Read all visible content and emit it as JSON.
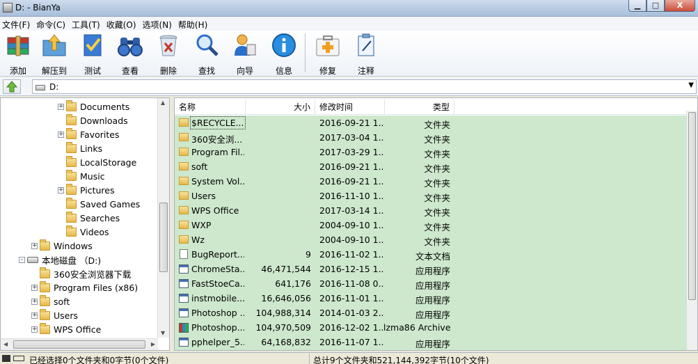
{
  "window": {
    "title": "D: - BianYa",
    "min_label": "▁",
    "max_label": "□",
    "close_label": "X"
  },
  "menu": [
    "文件(F)",
    "命令(C)",
    "工具(T)",
    "收藏(O)",
    "选项(N)",
    "帮助(H)"
  ],
  "toolbar": {
    "add": "添加",
    "extract": "解压到",
    "test": "测试",
    "view": "查看",
    "delete": "删除",
    "find": "查找",
    "wizard": "向导",
    "info": "信息",
    "repair": "修复",
    "comment": "注释"
  },
  "address": {
    "path": "D:"
  },
  "tree": [
    {
      "label": "Documents",
      "expander": "+"
    },
    {
      "label": "Downloads",
      "expander": ""
    },
    {
      "label": "Favorites",
      "expander": "+"
    },
    {
      "label": "Links",
      "expander": ""
    },
    {
      "label": "LocalStorage",
      "expander": ""
    },
    {
      "label": "Music",
      "expander": ""
    },
    {
      "label": "Pictures",
      "expander": "+"
    },
    {
      "label": "Saved Games",
      "expander": ""
    },
    {
      "label": "Searches",
      "expander": ""
    },
    {
      "label": "Videos",
      "expander": ""
    },
    {
      "label": "Windows",
      "expander": "+"
    },
    {
      "label": "本地磁盘 （D:)",
      "expander": "-"
    },
    {
      "label": "360安全浏览器下载",
      "expander": ""
    },
    {
      "label": "Program Files (x86)",
      "expander": "+"
    },
    {
      "label": "soft",
      "expander": "+"
    },
    {
      "label": "Users",
      "expander": "+"
    },
    {
      "label": "WPS Office",
      "expander": "+"
    }
  ],
  "list": {
    "headers": {
      "name": "名称",
      "size": "大小",
      "modified": "修改时间",
      "type": "类型"
    },
    "rows": [
      {
        "name": "$RECYCLE....",
        "size": "",
        "modified": "2016-09-21 1...",
        "type": "文件夹",
        "icon": "folder"
      },
      {
        "name": "360安全浏...",
        "size": "",
        "modified": "2017-03-04 1...",
        "type": "文件夹",
        "icon": "folder"
      },
      {
        "name": "Program Fil...",
        "size": "",
        "modified": "2017-03-29 1...",
        "type": "文件夹",
        "icon": "folder"
      },
      {
        "name": "soft",
        "size": "",
        "modified": "2016-09-21 1...",
        "type": "文件夹",
        "icon": "folder"
      },
      {
        "name": "System Vol...",
        "size": "",
        "modified": "2016-09-21 1...",
        "type": "文件夹",
        "icon": "folder"
      },
      {
        "name": "Users",
        "size": "",
        "modified": "2016-11-10 1...",
        "type": "文件夹",
        "icon": "folder"
      },
      {
        "name": "WPS Office",
        "size": "",
        "modified": "2017-03-14 1...",
        "type": "文件夹",
        "icon": "folder"
      },
      {
        "name": "WXP",
        "size": "",
        "modified": "2004-09-10 1...",
        "type": "文件夹",
        "icon": "folder"
      },
      {
        "name": "Wz",
        "size": "",
        "modified": "2004-09-10 1...",
        "type": "文件夹",
        "icon": "folder"
      },
      {
        "name": "BugReport....",
        "size": "9",
        "modified": "2016-11-02 1...",
        "type": "文本文档",
        "icon": "doc"
      },
      {
        "name": "ChromeSta...",
        "size": "46,471,544",
        "modified": "2016-12-15 1...",
        "type": "应用程序",
        "icon": "app"
      },
      {
        "name": "FastStoeCa...",
        "size": "641,176",
        "modified": "2016-11-08 0...",
        "type": "应用程序",
        "icon": "app"
      },
      {
        "name": "instmobile...",
        "size": "16,646,056",
        "modified": "2016-11-01 1...",
        "type": "应用程序",
        "icon": "app"
      },
      {
        "name": "Photoshop ...",
        "size": "104,988,314",
        "modified": "2014-01-03 2...",
        "type": "应用程序",
        "icon": "app"
      },
      {
        "name": "Photoshop....",
        "size": "104,970,509",
        "modified": "2016-12-02 1...",
        "type": "lzma86 Archive",
        "icon": "rar"
      },
      {
        "name": "pphelper_5...",
        "size": "64,168,832",
        "modified": "2016-11-07 1...",
        "type": "应用程序",
        "icon": "app"
      }
    ]
  },
  "status": {
    "left": "已经选择0个文件夹和0字节(0个文件)",
    "right": "总计9个文件夹和521,144,392字节(10个文件)"
  },
  "colors": {
    "list_bg": "#cde8cd",
    "accent": "#2a6fc9"
  }
}
